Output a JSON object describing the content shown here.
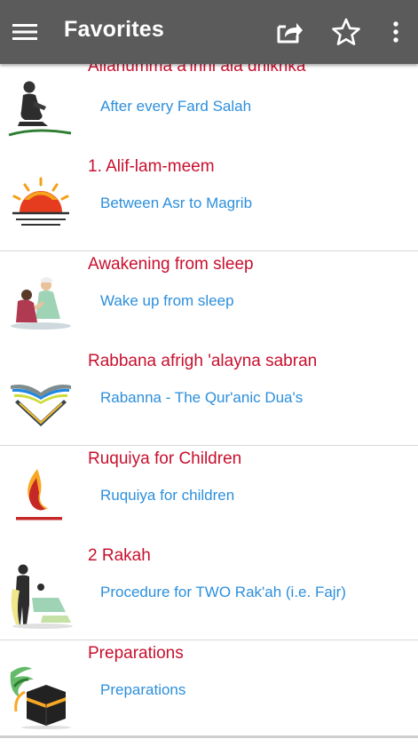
{
  "appbar": {
    "title": "Favorites",
    "background": "#5b5b5b",
    "icons": [
      "menu-icon",
      "share-icon",
      "star-outline-icon",
      "more-vert-icon"
    ]
  },
  "items": [
    {
      "title": "Allahumma a'inni ala dhikrika",
      "subtitle": "After every Fard Salah",
      "icon": "praying-man-icon"
    },
    {
      "title": "1. Alif-lam-meem",
      "subtitle": "Between Asr to Magrib",
      "icon": "sunset-icon"
    },
    {
      "title": "Awakening from sleep",
      "subtitle": "Wake up from sleep",
      "icon": "waking-people-icon"
    },
    {
      "title": "Rabbana afrigh 'alayna sabran",
      "subtitle": "Rabanna - The Qur'anic Dua's",
      "icon": "open-quran-icon"
    },
    {
      "title": "Ruquiya for Children",
      "subtitle": "Ruquiya for children",
      "icon": "flame-icon"
    },
    {
      "title": "2 Rakah",
      "subtitle": "Procedure for TWO Rak'ah (i.e. Fajr)",
      "icon": "prayer-positions-icon"
    },
    {
      "title": "Preparations",
      "subtitle": "Preparations",
      "icon": "kaaba-icon"
    }
  ],
  "colors": {
    "title": "#c8102e",
    "subtitle": "#2c8fdc",
    "divider": "#d6d6d6"
  }
}
